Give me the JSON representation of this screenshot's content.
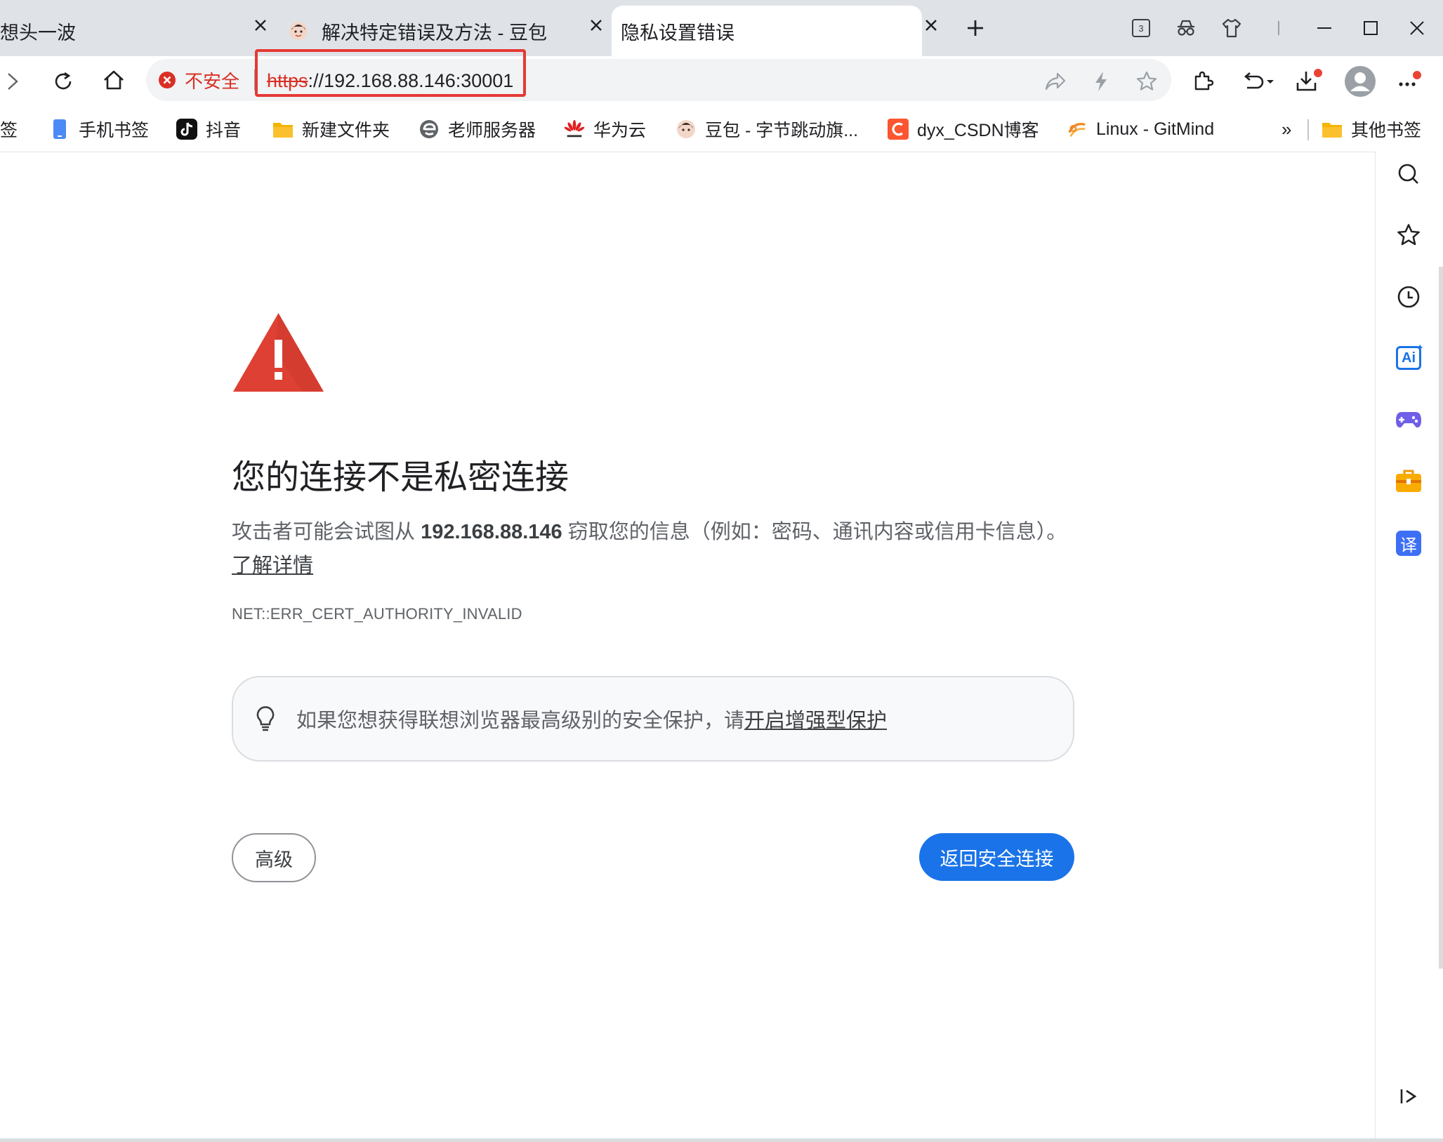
{
  "tabs": [
    {
      "title": "想头一波",
      "active": false
    },
    {
      "title": "解决特定错误及方法 - 豆包",
      "active": false
    },
    {
      "title": "隐私设置错误",
      "active": true
    }
  ],
  "tab_counter": "3",
  "address_bar": {
    "security_label": "不安全",
    "url_scheme": "https",
    "url_rest": "://192.168.88.146:30001"
  },
  "bookmarks": {
    "items": [
      {
        "label": "签",
        "icon": "bookmark-partial-icon"
      },
      {
        "label": "手机书签",
        "icon": "phone-icon"
      },
      {
        "label": "抖音",
        "icon": "tiktok-icon"
      },
      {
        "label": "新建文件夹",
        "icon": "folder-icon"
      },
      {
        "label": "老师服务器",
        "icon": "edge-icon"
      },
      {
        "label": "华为云",
        "icon": "huawei-icon"
      },
      {
        "label": "豆包 - 字节跳动旗...",
        "icon": "doubao-icon"
      },
      {
        "label": "dyx_CSDN博客",
        "icon": "csdn-icon"
      },
      {
        "label": "Linux - GitMind",
        "icon": "gitmind-icon"
      }
    ],
    "overflow": "»",
    "other_bookmarks": "其他书签"
  },
  "sidebar": {
    "items": [
      "search-icon",
      "star-icon",
      "history-icon",
      "ai-icon",
      "gamepad-icon",
      "toolbox-icon",
      "translate-icon"
    ],
    "translate_glyph": "译",
    "ai_glyph": "Ai"
  },
  "error_page": {
    "title": "您的连接不是私密连接",
    "description_before": "攻击者可能会试图从 ",
    "host": "192.168.88.146",
    "description_after": " 窃取您的信息（例如：密码、通讯内容或信用卡信息）。",
    "learn_more": "了解详情",
    "error_code": "NET::ERR_CERT_AUTHORITY_INVALID",
    "tip_text": "如果您想获得联想浏览器最高级别的安全保护，请",
    "tip_link": "开启增强型保护",
    "advanced_button": "高级",
    "back_button": "返回安全连接"
  },
  "colors": {
    "accent": "#1a73e8",
    "danger": "#d93025",
    "warning_triangle": "#de4033",
    "highlight_box": "#e53935"
  }
}
